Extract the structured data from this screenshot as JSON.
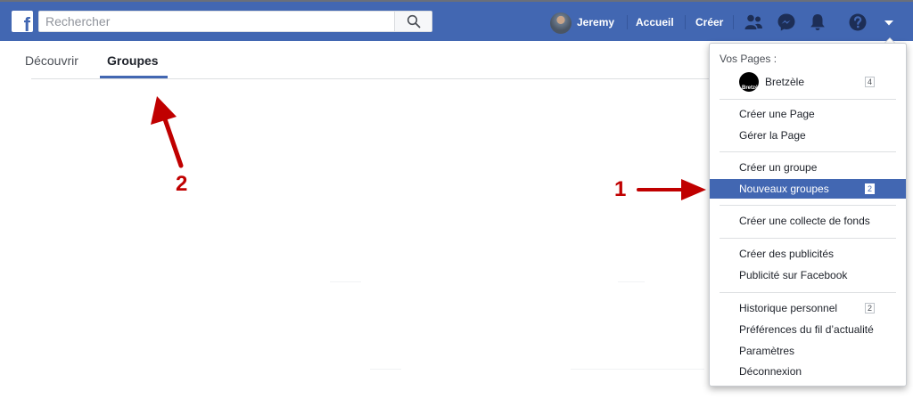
{
  "topbar": {
    "logo_letter": "f",
    "search": {
      "placeholder": "Rechercher",
      "value": ""
    },
    "user_name": "Jeremy",
    "home_label": "Accueil",
    "create_label": "Créer",
    "icons": [
      "friends-icon",
      "messenger-icon",
      "notifications-bell-icon",
      "help-icon",
      "account-menu-chevron-icon"
    ],
    "colors": {
      "bar": "#4267b2",
      "accent": "#4267b2"
    }
  },
  "tabs": [
    {
      "label": "Découvrir",
      "active": false
    },
    {
      "label": "Groupes",
      "active": true
    }
  ],
  "menu": {
    "pages_header": "Vos Pages :",
    "page": {
      "name": "Bretzèle",
      "logo_text": "Bretzèle",
      "badge": "4"
    },
    "items": [
      {
        "label": "Créer une Page",
        "badge": ""
      },
      {
        "label": "Gérer la Page",
        "badge": ""
      },
      {
        "label": "Créer un groupe",
        "badge": ""
      },
      {
        "label": "Nouveaux groupes",
        "badge": "2",
        "highlighted": true
      },
      {
        "label": "Créer une collecte de fonds",
        "badge": ""
      },
      {
        "label": "Créer des publicités",
        "badge": ""
      },
      {
        "label": "Publicité sur Facebook",
        "badge": ""
      },
      {
        "label": "Historique personnel",
        "badge": "2"
      },
      {
        "label": "Préférences du fil d’actualité",
        "badge": ""
      },
      {
        "label": "Paramètres",
        "badge": ""
      },
      {
        "label": "Déconnexion",
        "badge": ""
      }
    ]
  },
  "annotations": {
    "step1": "1",
    "step2": "2",
    "color": "#c00000"
  }
}
